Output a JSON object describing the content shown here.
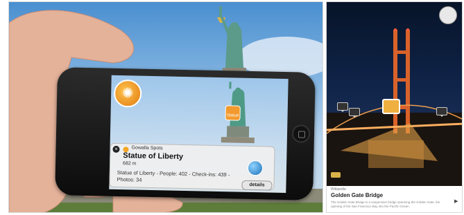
{
  "left_scene": {
    "card": {
      "source_label": "Gowalla Spots",
      "title": "Statue of Liberty",
      "distance": "682 m",
      "stats": "Statue of Liberty - People: 402 - Check-ins: 439 -",
      "photos": "Photos: 34",
      "details_label": "details"
    },
    "marker_label": "Statue"
  },
  "right_scene": {
    "card": {
      "source": "Wikipedia",
      "title": "Golden Gate Bridge",
      "description": "The Golden Gate Bridge is a suspension bridge spanning the Golden Gate, the opening of the San Francisco Bay into the Pacific Ocean."
    }
  },
  "colors": {
    "accent_orange": "#f29a2e",
    "sky": "#7fb2e0",
    "night": "#10244a"
  }
}
